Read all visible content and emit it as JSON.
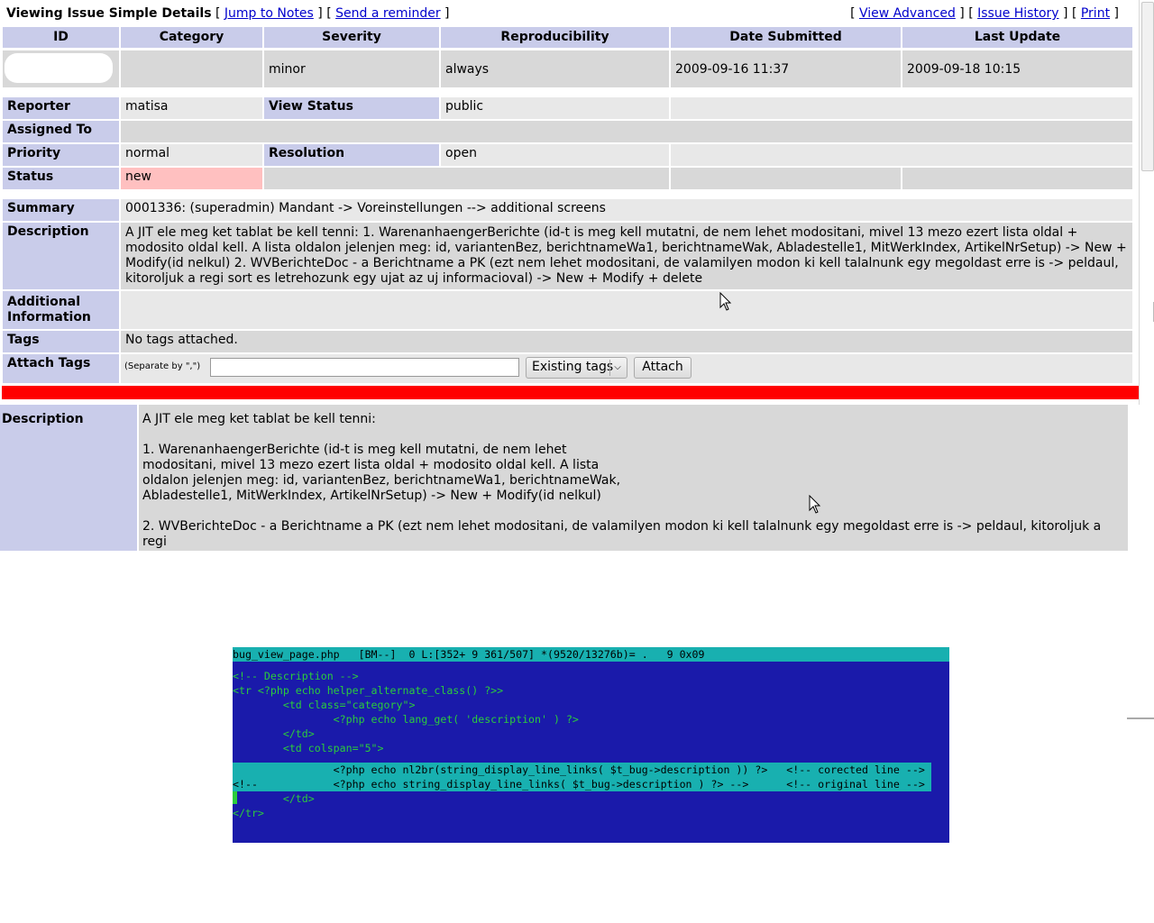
{
  "issue": {
    "heading": "Viewing Issue Simple Details",
    "links_left": [
      "Jump to Notes",
      "Send a reminder"
    ],
    "links_right": [
      "View Advanced",
      "Issue History",
      "Print"
    ],
    "columns": [
      "ID",
      "Category",
      "Severity",
      "Reproducibility",
      "Date Submitted",
      "Last Update"
    ],
    "severity": "minor",
    "reproducibility": "always",
    "date_submitted": "2009-09-16 11:37",
    "last_update": "2009-09-18 10:15",
    "labels": {
      "reporter": "Reporter",
      "view_status": "View Status",
      "assigned_to": "Assigned To",
      "priority": "Priority",
      "resolution": "Resolution",
      "status": "Status",
      "summary": "Summary",
      "description": "Description",
      "additional": "Additional Information",
      "tags": "Tags",
      "attach_tags": "Attach Tags"
    },
    "reporter": "matisa",
    "view_status": "public",
    "priority": "normal",
    "resolution": "open",
    "status": "new",
    "summary": "0001336: (superadmin) Mandant -> Voreinstellungen --> additional screens",
    "description": "A JIT ele meg ket tablat be kell tenni: 1. WarenanhaengerBerichte (id-t is meg kell mutatni, de nem lehet modositani, mivel 13 mezo ezert lista oldal + modosito oldal kell. A lista oldalon jelenjen meg: id, variantenBez, berichtnameWa1, berichtnameWak, Abladestelle1, MitWerkIndex, ArtikelNrSetup) -> New + Modify(id nelkul) 2. WVBerichteDoc - a Berichtname a PK (ezt nem lehet modositani, de valamilyen modon ki kell talalnunk egy megoldast erre is -> peldaul, kitoroljuk a regi sort es letrehozunk egy ujat az uj informacioval) -> New + Modify + delete",
    "tags_value": "No tags attached.",
    "separate_hint": "(Separate by \",\")",
    "tag_input_value": "",
    "existing_tags": "Existing tags",
    "attach_button": "Attach",
    "status_color": "#ffc0c0",
    "highlight_color": "#ff0000"
  },
  "fixed_view": {
    "label": "Description",
    "text": "A JIT ele meg ket tablat be kell tenni:\n\n1. WarenanhaengerBerichte (id-t is meg kell mutatni, de nem lehet\nmodositani, mivel 13 mezo ezert lista oldal + modosito oldal kell. A lista\noldalon jelenjen meg: id, variantenBez, berichtnameWa1, berichtnameWak,\nAbladestelle1, MitWerkIndex, ArtikelNrSetup) -> New + Modify(id nelkul)\n\n2. WVBerichteDoc - a Berichtname a PK (ezt nem lehet modositani, de valamilyen modon ki kell talalnunk egy megoldast erre is -> peldaul, kitoroljuk a regi\nsort es letrehozunk egy ujat az uj informacioval) -> New + Modify + delete"
  },
  "editor": {
    "status_line": "bug_view_page.php   [BM--]  0 L:[352+ 9 361/507] *(9520/13276b)= .   9 0x09",
    "lines": [
      "",
      "<!-- Description -->",
      "<tr <?php echo helper_alternate_class() ?>>",
      "        <td class=\"category\">",
      "                <?php echo lang_get( 'description' ) ?>",
      "        </td>",
      "        <td colspan=\"5\">",
      "                <?php echo nl2br(string_display_line_links( $t_bug->description )) ?>   <!-- corected line -->",
      "<!--            <?php echo string_display_line_links( $t_bug->description ) ?> -->      <!-- original line -->",
      "        </td>",
      "</tr>"
    ],
    "bg_color": "#1a1aaa",
    "text_color": "#2bcc3c",
    "highlight_color": "#18b0b0"
  }
}
